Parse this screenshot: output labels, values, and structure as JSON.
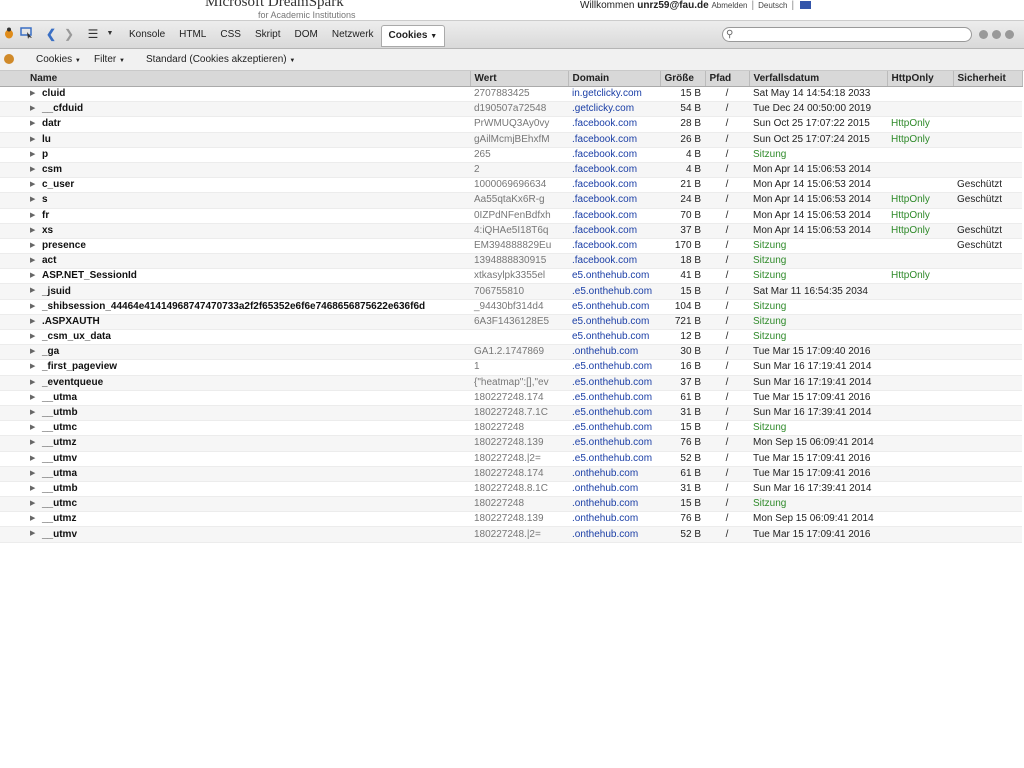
{
  "site": {
    "title": "Microsoft DreamSpark",
    "subtitle": "for Academic Institutions",
    "welcome": "Willkommen",
    "user": "unrz59@fau.de",
    "logout": "Abmelden",
    "language": "Deutsch"
  },
  "toolbar": {
    "tabs": [
      "Konsole",
      "HTML",
      "CSS",
      "Skript",
      "DOM",
      "Netzwerk",
      "Cookies"
    ],
    "active_tab": "Cookies",
    "search_value": ""
  },
  "subbar": {
    "cookies_menu": "Cookies",
    "filter_menu": "Filter",
    "standard_menu": "Standard (Cookies akzeptieren)"
  },
  "columns": [
    "Name",
    "Wert",
    "Domain",
    "Größe",
    "Pfad",
    "Verfallsdatum",
    "HttpOnly",
    "Sicherheit"
  ],
  "rows": [
    [
      "cluid",
      "2707883425",
      "in.getclicky.com",
      "15 B",
      "/",
      "Sat May 14 14:54:18 2033",
      "",
      ""
    ],
    [
      "__cfduid",
      "d190507a72548",
      ".getclicky.com",
      "54 B",
      "/",
      "Tue Dec 24 00:50:00 2019",
      "",
      ""
    ],
    [
      "datr",
      "PrWMUQ3Ay0vy",
      ".facebook.com",
      "28 B",
      "/",
      "Sun Oct 25 17:07:22 2015",
      "HttpOnly",
      ""
    ],
    [
      "lu",
      "gAilMcmjBEhxfM",
      ".facebook.com",
      "26 B",
      "/",
      "Sun Oct 25 17:07:24 2015",
      "HttpOnly",
      ""
    ],
    [
      "p",
      "265",
      ".facebook.com",
      "4 B",
      "/",
      "Sitzung",
      "",
      ""
    ],
    [
      "csm",
      "2",
      ".facebook.com",
      "4 B",
      "/",
      "Mon Apr 14 15:06:53 2014",
      "",
      ""
    ],
    [
      "c_user",
      "1000069696634",
      ".facebook.com",
      "21 B",
      "/",
      "Mon Apr 14 15:06:53 2014",
      "",
      "Geschützt"
    ],
    [
      "s",
      "Aa55qtaKx6R-g",
      ".facebook.com",
      "24 B",
      "/",
      "Mon Apr 14 15:06:53 2014",
      "HttpOnly",
      "Geschützt"
    ],
    [
      "fr",
      "0IZPdNFenBdfxh",
      ".facebook.com",
      "70 B",
      "/",
      "Mon Apr 14 15:06:53 2014",
      "HttpOnly",
      ""
    ],
    [
      "xs",
      "4:iQHAe5I18T6q",
      ".facebook.com",
      "37 B",
      "/",
      "Mon Apr 14 15:06:53 2014",
      "HttpOnly",
      "Geschützt"
    ],
    [
      "presence",
      "EM394888829Eu",
      ".facebook.com",
      "170 B",
      "/",
      "Sitzung",
      "",
      "Geschützt"
    ],
    [
      "act",
      "1394888830915",
      ".facebook.com",
      "18 B",
      "/",
      "Sitzung",
      "",
      ""
    ],
    [
      "ASP.NET_SessionId",
      "xtkasylpk3355el",
      "e5.onthehub.com",
      "41 B",
      "/",
      "Sitzung",
      "HttpOnly",
      ""
    ],
    [
      "_jsuid",
      "706755810",
      ".e5.onthehub.com",
      "15 B",
      "/",
      "Sat Mar 11 16:54:35 2034",
      "",
      ""
    ],
    [
      "_shibsession_44464e41414968747470733a2f2f65352e6f6e7468656875622e636f6d",
      "_94430bf314d4",
      "e5.onthehub.com",
      "104 B",
      "/",
      "Sitzung",
      "",
      ""
    ],
    [
      ".ASPXAUTH",
      "6A3F1436128E5",
      "e5.onthehub.com",
      "721 B",
      "/",
      "Sitzung",
      "",
      ""
    ],
    [
      "_csm_ux_data",
      "",
      "e5.onthehub.com",
      "12 B",
      "/",
      "Sitzung",
      "",
      ""
    ],
    [
      "_ga",
      "GA1.2.1747869",
      ".onthehub.com",
      "30 B",
      "/",
      "Tue Mar 15 17:09:40 2016",
      "",
      ""
    ],
    [
      "_first_pageview",
      "1",
      ".e5.onthehub.com",
      "16 B",
      "/",
      "Sun Mar 16 17:19:41 2014",
      "",
      ""
    ],
    [
      "_eventqueue",
      "{\"heatmap\":[],\"ev",
      ".e5.onthehub.com",
      "37 B",
      "/",
      "Sun Mar 16 17:19:41 2014",
      "",
      ""
    ],
    [
      "__utma",
      "180227248.174",
      ".e5.onthehub.com",
      "61 B",
      "/",
      "Tue Mar 15 17:09:41 2016",
      "",
      ""
    ],
    [
      "__utmb",
      "180227248.7.1C",
      ".e5.onthehub.com",
      "31 B",
      "/",
      "Sun Mar 16 17:39:41 2014",
      "",
      ""
    ],
    [
      "__utmc",
      "180227248",
      ".e5.onthehub.com",
      "15 B",
      "/",
      "Sitzung",
      "",
      ""
    ],
    [
      "__utmz",
      "180227248.139",
      ".e5.onthehub.com",
      "76 B",
      "/",
      "Mon Sep 15 06:09:41 2014",
      "",
      ""
    ],
    [
      "__utmv",
      "180227248.|2=",
      ".e5.onthehub.com",
      "52 B",
      "/",
      "Tue Mar 15 17:09:41 2016",
      "",
      ""
    ],
    [
      "__utma",
      "180227248.174",
      ".onthehub.com",
      "61 B",
      "/",
      "Tue Mar 15 17:09:41 2016",
      "",
      ""
    ],
    [
      "__utmb",
      "180227248.8.1C",
      ".onthehub.com",
      "31 B",
      "/",
      "Sun Mar 16 17:39:41 2014",
      "",
      ""
    ],
    [
      "__utmc",
      "180227248",
      ".onthehub.com",
      "15 B",
      "/",
      "Sitzung",
      "",
      ""
    ],
    [
      "__utmz",
      "180227248.139",
      ".onthehub.com",
      "76 B",
      "/",
      "Mon Sep 15 06:09:41 2014",
      "",
      ""
    ],
    [
      "__utmv",
      "180227248.|2=",
      ".onthehub.com",
      "52 B",
      "/",
      "Tue Mar 15 17:09:41 2016",
      "",
      ""
    ]
  ],
  "colors": {
    "domain": "#1a3ea6",
    "green": "#2f8a2a"
  }
}
